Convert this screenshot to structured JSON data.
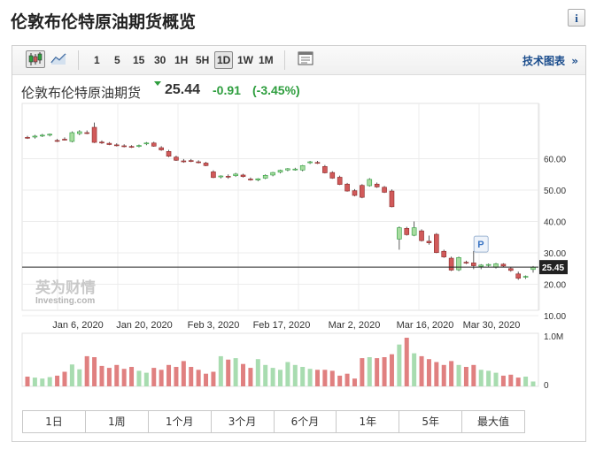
{
  "page": {
    "title": "伦敦布伦特原油期货概览",
    "info_icon": "i"
  },
  "toolbar": {
    "chart_type_icons": [
      "candlestick-icon",
      "line-chart-icon"
    ],
    "timeframes": [
      "1",
      "5",
      "15",
      "30",
      "1H",
      "5H",
      "1D",
      "1W",
      "1M"
    ],
    "selected_timeframe": "1D",
    "settings_icon": "chart-settings-icon",
    "advanced_chart": "技术图表",
    "advanced_arrow": "»"
  },
  "quote": {
    "name": "伦敦布伦特原油期货",
    "price": "25.44",
    "change": "-0.91",
    "change_pct": "(-3.45%)"
  },
  "watermark": {
    "cn": "英为财情",
    "en": "Investing.com"
  },
  "ranges": [
    "1日",
    "1周",
    "1个月",
    "3个月",
    "6个月",
    "1年",
    "5年",
    "最大值"
  ],
  "colors": {
    "up": "#2e9e3e",
    "up_fill": "#a8dca0",
    "down": "#d15a5a",
    "vol_up": "#a8dcb0",
    "vol_down": "#e08080",
    "link": "#1a4c8c"
  },
  "chart_data": {
    "type": "candlestick",
    "current_price_label": "25.45",
    "event_marker": "P",
    "price_axis": {
      "ticks": [
        "60.00",
        "50.00",
        "40.00",
        "30.00",
        "20.00",
        "10.00"
      ],
      "ylim": [
        10,
        70
      ]
    },
    "volume_axis": {
      "ticks": [
        "1.0M",
        "0"
      ]
    },
    "x_ticks": [
      "Jan 6, 2020",
      "Jan 20, 2020",
      "Feb 3, 2020",
      "Feb 17, 2020",
      "Mar 2, 2020",
      "Mar 16, 2020",
      "Mar 30, 2020"
    ],
    "candles": [
      {
        "o": 66.8,
        "h": 67.3,
        "l": 66.3,
        "c": 66.6
      },
      {
        "o": 66.9,
        "h": 67.6,
        "l": 66.4,
        "c": 67.2
      },
      {
        "o": 67.3,
        "h": 67.9,
        "l": 66.9,
        "c": 67.5
      },
      {
        "o": 67.5,
        "h": 68.0,
        "l": 67.1,
        "c": 67.8
      },
      {
        "o": 65.8,
        "h": 66.3,
        "l": 65.3,
        "c": 65.6
      },
      {
        "o": 66.2,
        "h": 66.8,
        "l": 65.8,
        "c": 66.0
      },
      {
        "o": 65.5,
        "h": 68.7,
        "l": 65.2,
        "c": 68.3
      },
      {
        "o": 68.0,
        "h": 69.1,
        "l": 67.5,
        "c": 68.6
      },
      {
        "o": 68.3,
        "h": 69.0,
        "l": 67.8,
        "c": 68.2
      },
      {
        "o": 70.0,
        "h": 71.5,
        "l": 65.0,
        "c": 65.2
      },
      {
        "o": 65.3,
        "h": 65.8,
        "l": 64.7,
        "c": 65.0
      },
      {
        "o": 64.9,
        "h": 65.3,
        "l": 64.3,
        "c": 64.5
      },
      {
        "o": 64.4,
        "h": 64.9,
        "l": 63.9,
        "c": 64.3
      },
      {
        "o": 64.1,
        "h": 64.6,
        "l": 63.6,
        "c": 64.0
      },
      {
        "o": 63.9,
        "h": 64.3,
        "l": 63.4,
        "c": 63.8
      },
      {
        "o": 64.0,
        "h": 64.5,
        "l": 63.6,
        "c": 64.2
      },
      {
        "o": 64.8,
        "h": 65.3,
        "l": 64.3,
        "c": 65.0
      },
      {
        "o": 65.0,
        "h": 65.4,
        "l": 63.8,
        "c": 64.0
      },
      {
        "o": 63.5,
        "h": 64.0,
        "l": 62.5,
        "c": 62.8
      },
      {
        "o": 62.3,
        "h": 62.8,
        "l": 60.5,
        "c": 60.8
      },
      {
        "o": 60.5,
        "h": 61.0,
        "l": 59.3,
        "c": 59.5
      },
      {
        "o": 59.3,
        "h": 59.9,
        "l": 58.7,
        "c": 59.0
      },
      {
        "o": 59.4,
        "h": 59.9,
        "l": 58.9,
        "c": 59.2
      },
      {
        "o": 59.0,
        "h": 59.5,
        "l": 58.5,
        "c": 58.8
      },
      {
        "o": 58.6,
        "h": 59.0,
        "l": 57.6,
        "c": 57.8
      },
      {
        "o": 55.8,
        "h": 56.3,
        "l": 53.8,
        "c": 54.0
      },
      {
        "o": 54.2,
        "h": 54.7,
        "l": 53.7,
        "c": 54.5
      },
      {
        "o": 54.4,
        "h": 55.0,
        "l": 53.6,
        "c": 54.2
      },
      {
        "o": 54.6,
        "h": 55.5,
        "l": 54.2,
        "c": 55.1
      },
      {
        "o": 54.8,
        "h": 55.2,
        "l": 54.0,
        "c": 54.3
      },
      {
        "o": 53.5,
        "h": 54.0,
        "l": 53.0,
        "c": 53.3
      },
      {
        "o": 53.2,
        "h": 53.8,
        "l": 52.8,
        "c": 53.6
      },
      {
        "o": 53.8,
        "h": 55.0,
        "l": 53.5,
        "c": 54.7
      },
      {
        "o": 54.8,
        "h": 55.8,
        "l": 54.4,
        "c": 55.6
      },
      {
        "o": 55.7,
        "h": 56.5,
        "l": 55.3,
        "c": 56.3
      },
      {
        "o": 56.4,
        "h": 57.0,
        "l": 56.0,
        "c": 56.8
      },
      {
        "o": 56.6,
        "h": 57.1,
        "l": 56.2,
        "c": 56.7
      },
      {
        "o": 56.4,
        "h": 58.0,
        "l": 56.0,
        "c": 57.8
      },
      {
        "o": 58.7,
        "h": 59.3,
        "l": 58.3,
        "c": 59.0
      },
      {
        "o": 58.8,
        "h": 59.3,
        "l": 58.3,
        "c": 58.7
      },
      {
        "o": 57.5,
        "h": 58.0,
        "l": 55.3,
        "c": 55.5
      },
      {
        "o": 55.6,
        "h": 56.0,
        "l": 53.6,
        "c": 53.8
      },
      {
        "o": 54.1,
        "h": 54.6,
        "l": 51.6,
        "c": 51.8
      },
      {
        "o": 51.9,
        "h": 52.3,
        "l": 49.5,
        "c": 49.7
      },
      {
        "o": 49.8,
        "h": 50.3,
        "l": 48.0,
        "c": 48.3
      },
      {
        "o": 51.5,
        "h": 51.9,
        "l": 47.4,
        "c": 47.7
      },
      {
        "o": 51.4,
        "h": 53.8,
        "l": 51.1,
        "c": 53.4
      },
      {
        "o": 51.9,
        "h": 52.4,
        "l": 50.7,
        "c": 51.0
      },
      {
        "o": 50.9,
        "h": 51.3,
        "l": 49.1,
        "c": 49.3
      },
      {
        "o": 49.7,
        "h": 50.2,
        "l": 44.5,
        "c": 44.7
      },
      {
        "o": 34.4,
        "h": 38.4,
        "l": 31.0,
        "c": 38.0
      },
      {
        "o": 37.8,
        "h": 38.3,
        "l": 35.5,
        "c": 35.8
      },
      {
        "o": 35.6,
        "h": 40.0,
        "l": 35.3,
        "c": 38.0
      },
      {
        "o": 37.0,
        "h": 37.5,
        "l": 33.6,
        "c": 33.9
      },
      {
        "o": 33.7,
        "h": 35.5,
        "l": 32.6,
        "c": 33.2
      },
      {
        "o": 35.9,
        "h": 36.3,
        "l": 29.9,
        "c": 30.1
      },
      {
        "o": 30.5,
        "h": 31.0,
        "l": 28.4,
        "c": 28.7
      },
      {
        "o": 28.3,
        "h": 28.8,
        "l": 24.2,
        "c": 24.5
      },
      {
        "o": 24.6,
        "h": 28.8,
        "l": 24.2,
        "c": 28.5
      },
      {
        "o": 27.0,
        "h": 27.5,
        "l": 26.4,
        "c": 26.9
      },
      {
        "o": 26.8,
        "h": 30.6,
        "l": 24.8,
        "c": 25.9
      },
      {
        "o": 25.7,
        "h": 26.4,
        "l": 24.8,
        "c": 26.1
      },
      {
        "o": 26.0,
        "h": 26.6,
        "l": 25.6,
        "c": 26.3
      },
      {
        "o": 25.4,
        "h": 26.8,
        "l": 25.0,
        "c": 26.5
      },
      {
        "o": 26.4,
        "h": 26.7,
        "l": 25.5,
        "c": 25.8
      },
      {
        "o": 25.0,
        "h": 25.5,
        "l": 24.0,
        "c": 24.4
      },
      {
        "o": 23.3,
        "h": 24.0,
        "l": 21.4,
        "c": 21.9
      },
      {
        "o": 22.3,
        "h": 22.8,
        "l": 21.7,
        "c": 22.5
      },
      {
        "o": 24.7,
        "h": 25.8,
        "l": 23.7,
        "c": 25.4
      }
    ],
    "volume": [
      0.2,
      0.18,
      0.16,
      0.19,
      0.22,
      0.3,
      0.45,
      0.35,
      0.62,
      0.6,
      0.42,
      0.38,
      0.44,
      0.36,
      0.4,
      0.32,
      0.28,
      0.38,
      0.34,
      0.44,
      0.4,
      0.52,
      0.4,
      0.34,
      0.26,
      0.3,
      0.62,
      0.55,
      0.58,
      0.46,
      0.38,
      0.56,
      0.44,
      0.38,
      0.34,
      0.5,
      0.44,
      0.4,
      0.36,
      0.34,
      0.34,
      0.32,
      0.22,
      0.26,
      0.16,
      0.58,
      0.6,
      0.58,
      0.6,
      0.66,
      0.86,
      1.0,
      0.68,
      0.62,
      0.56,
      0.5,
      0.44,
      0.52,
      0.44,
      0.4,
      0.44,
      0.34,
      0.32,
      0.28,
      0.22,
      0.24,
      0.18,
      0.2,
      0.1
    ]
  }
}
